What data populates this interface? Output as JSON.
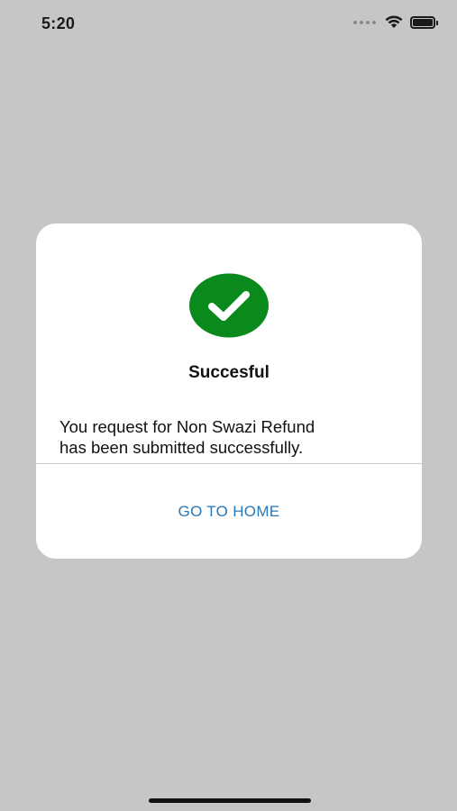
{
  "status_bar": {
    "time": "5:20",
    "icons": [
      "signal-dots-icon",
      "wifi-icon",
      "battery-icon"
    ]
  },
  "dialog": {
    "icon": "check-circle-icon",
    "icon_color": "#0a8a1c",
    "title": "Succesful",
    "message_line1": "You request for Non Swazi Refund",
    "message_line2": "has been submitted successfully.",
    "button_label": "GO TO HOME",
    "button_color": "#2a78b5"
  },
  "colors": {
    "overlay_background": "#c6c6c6",
    "dialog_background": "#ffffff"
  }
}
